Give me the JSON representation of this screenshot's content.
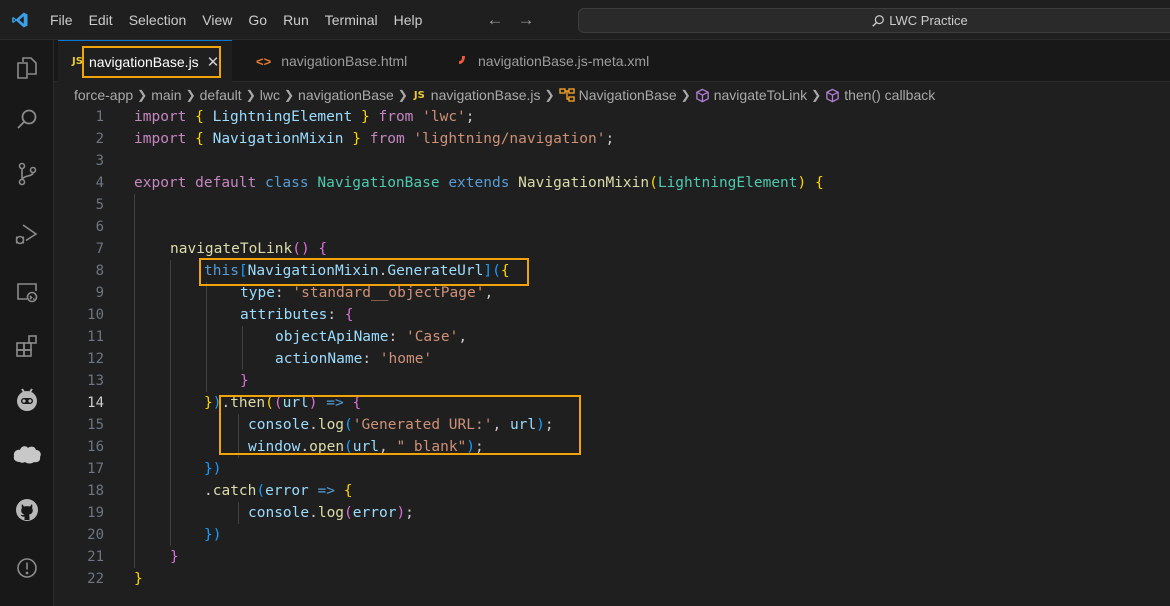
{
  "menu": [
    "File",
    "Edit",
    "Selection",
    "View",
    "Go",
    "Run",
    "Terminal",
    "Help"
  ],
  "search": {
    "label": "LWC Practice"
  },
  "tabs": [
    {
      "label": "navigationBase.js",
      "badge": "JS"
    },
    {
      "label": "navigationBase.html",
      "badge": "<>"
    },
    {
      "label": "navigationBase.js-meta.xml",
      "badge": "░"
    }
  ],
  "breadcrumb": [
    "force-app",
    "main",
    "default",
    "lwc",
    "navigationBase",
    "navigationBase.js",
    "NavigationBase",
    "navigateToLink",
    "then() callback"
  ],
  "current_line": 14,
  "colors": {
    "highlight": "#f0a30a",
    "accent": "#0078d4"
  },
  "icons": [
    "vscode-logo-icon",
    "explorer-icon",
    "search-icon",
    "source-control-icon",
    "run-debug-icon",
    "remote-explorer-icon",
    "extensions-icon",
    "copilot-icon",
    "salesforce-icon",
    "github-icon",
    "problems-icon"
  ],
  "code": {
    "l1": [
      "import",
      "{",
      "LightningElement",
      "}",
      "from",
      "'lwc'",
      ";"
    ],
    "l2": [
      "import",
      "{",
      "NavigationMixin",
      "}",
      "from",
      "'lightning/navigation'",
      ";"
    ],
    "l4": [
      "export",
      "default",
      "class",
      "NavigationBase",
      "extends",
      "NavigationMixin",
      "(",
      "LightningElement",
      ")",
      "{"
    ],
    "l7": [
      "navigateToLink",
      "()",
      "{"
    ],
    "l8": [
      "this",
      "[",
      "NavigationMixin",
      ".",
      "GenerateUrl",
      "]",
      "(",
      "{"
    ],
    "l9": [
      "type",
      ":",
      "'standard__objectPage'",
      ","
    ],
    "l10": [
      "attributes",
      ":",
      "{"
    ],
    "l11": [
      "objectApiName",
      ":",
      "'Case'",
      ","
    ],
    "l12": [
      "actionName",
      ":",
      "'home'"
    ],
    "l13": [
      "}"
    ],
    "l14": [
      "}",
      ")",
      ".",
      "then",
      "(",
      "(",
      "url",
      ")",
      "=>",
      "{"
    ],
    "l15": [
      "console",
      ".",
      "log",
      "(",
      "'Generated URL:'",
      ", ",
      "url",
      ")",
      ";"
    ],
    "l16": [
      "window",
      ".",
      "open",
      "(",
      "url",
      ", ",
      "\" blank\"",
      ")",
      ";"
    ],
    "l17": [
      "})"
    ],
    "l18": [
      ".",
      "catch",
      "(",
      "error",
      "=>",
      "{"
    ],
    "l19": [
      "console",
      ".",
      "log",
      "(",
      "error",
      ")",
      ";"
    ],
    "l20": [
      "})"
    ],
    "l21": [
      "}"
    ],
    "l22": [
      "}"
    ]
  }
}
